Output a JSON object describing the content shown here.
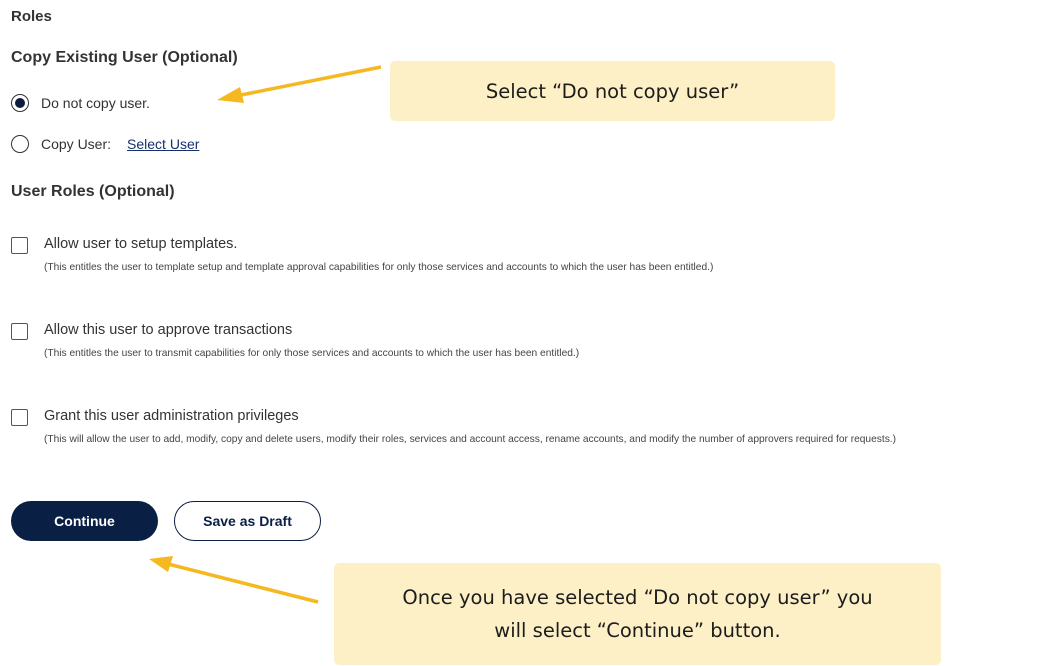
{
  "page": {
    "roles_heading": "Roles",
    "copy_existing_heading": "Copy Existing User (Optional)",
    "radio_do_not_copy": {
      "label": "Do not copy user.",
      "selected": true
    },
    "radio_copy_user": {
      "label": "Copy User:",
      "selected": false,
      "link": "Select User"
    },
    "user_roles_heading": "User Roles (Optional)",
    "roles": [
      {
        "label": "Allow user to setup templates.",
        "description": "(This entitles the user to template setup and template approval capabilities for only those services and accounts to which the user has been entitled.)",
        "checked": false
      },
      {
        "label": "Allow this user to approve transactions",
        "description": "(This entitles the user to transmit capabilities for only those services and accounts to which the user has been entitled.)",
        "checked": false
      },
      {
        "label": "Grant this user administration privileges",
        "description": "(This will allow the user to add, modify, copy and delete users, modify their roles, services and account access, rename accounts, and modify the number of approvers required for requests.)",
        "checked": false
      }
    ],
    "continue_label": "Continue",
    "save_draft_label": "Save as Draft"
  },
  "annotations": {
    "callout_1": "Select “Do not copy user”",
    "callout_2_line1": "Once you have selected “Do not copy user” you",
    "callout_2_line2": "will select “Continue” button.",
    "arrow_color": "#f5b820",
    "callout_bg": "#fdf0c7"
  },
  "colors": {
    "primary_button": "#0a1f44",
    "link": "#16306b"
  }
}
